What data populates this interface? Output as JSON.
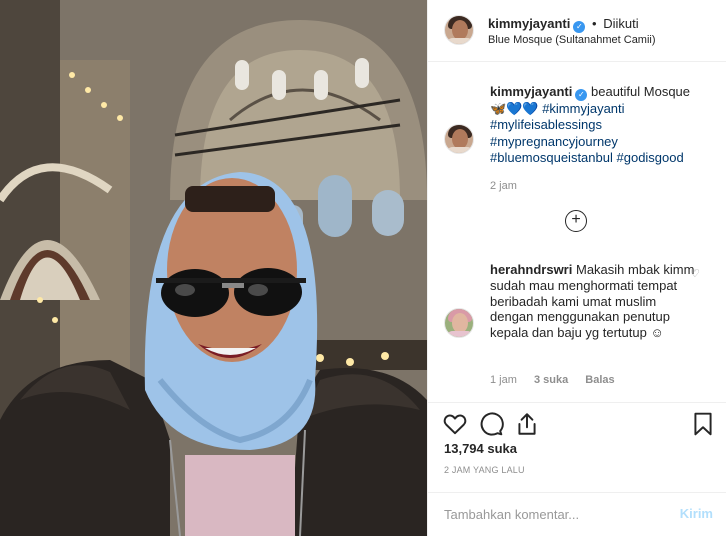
{
  "post": {
    "username": "kimmyjayanti",
    "follow_status": "Diikuti",
    "location": "Blue Mosque (Sultanahmet Camii)"
  },
  "caption": {
    "username": "kimmyjayanti",
    "text": "beautiful Mosque",
    "emoji": "🦋💙💙",
    "hashtags": [
      "#kimmyjayanti",
      "#mylifeisablessings",
      "#mypregnancyjourney",
      "#bluemosqueistanbul",
      "#godisgood"
    ],
    "time": "2 jam"
  },
  "comment": {
    "username": "herahndrswri",
    "text": "Makasih mbak kimm sudah mau menghormati tempat beribadah kami umat muslim dengan menggunakan penutup kepala dan baju yg tertutup ☺",
    "time": "1 jam",
    "likes": "3 suka",
    "reply": "Balas"
  },
  "stats": {
    "likes": "13,794 suka",
    "time_ago": "2 JAM YANG LALU"
  },
  "composer": {
    "placeholder": "Tambahkan komentar...",
    "post_label": "Kirim"
  },
  "icons": {
    "like": "heart-icon",
    "comment": "comment-icon",
    "share": "share-icon",
    "save": "bookmark-icon",
    "add_more": "plus-circle-icon"
  },
  "colors": {
    "verified": "#3897f0",
    "hashtag": "#00376b",
    "secondary_text": "#8e8e8e",
    "post_disabled": "#b2dffc"
  }
}
